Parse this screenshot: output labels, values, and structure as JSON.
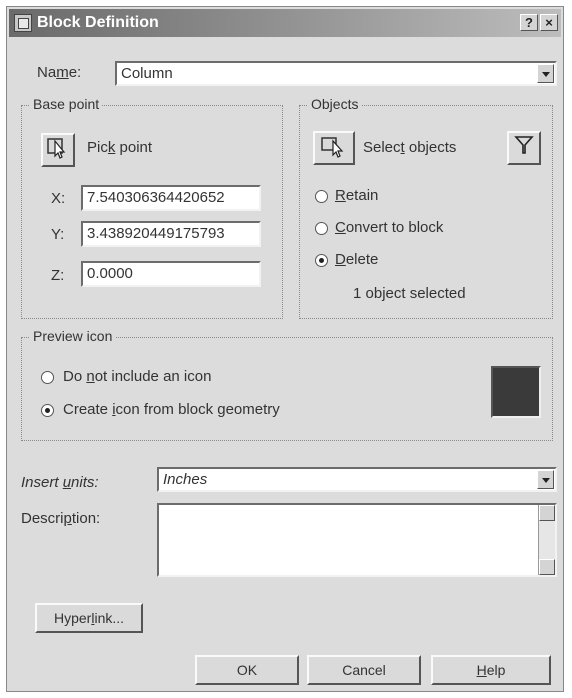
{
  "window": {
    "title": "Block Definition",
    "help_glyph": "?",
    "close_glyph": "×"
  },
  "name": {
    "label_pre": "Na",
    "label_key": "m",
    "label_post": "e:",
    "value": "Column"
  },
  "base_point": {
    "title": "Base point",
    "pick_label_pre": "Pic",
    "pick_label_key": "k",
    "pick_label_post": " point",
    "x_label": "X:",
    "x_value": "7.540306364420652",
    "y_label": "Y:",
    "y_value": "3.438920449175793",
    "z_label": "Z:",
    "z_value": "0.0000",
    "pick_icon": "pick-point-icon"
  },
  "objects": {
    "title": "Objects",
    "select_label_pre": "Selec",
    "select_label_key": "t",
    "select_label_post": " objects",
    "retain": {
      "key": "R",
      "rest": "etain",
      "selected": false
    },
    "convert": {
      "key": "C",
      "rest": "onvert to block",
      "selected": false
    },
    "delete": {
      "key": "D",
      "rest": "elete",
      "selected": true
    },
    "status": "1 object selected",
    "select_icon": "select-objects-icon",
    "filter_icon": "quick-select-filter-icon"
  },
  "preview": {
    "title": "Preview icon",
    "opt1_pre": "Do ",
    "opt1_key": "n",
    "opt1_post": "ot include an icon",
    "opt2_pre": "Create ",
    "opt2_key": "i",
    "opt2_post": "con from block geometry",
    "selected": "create",
    "swatch_color": "#3a3a3a"
  },
  "insert_units": {
    "label_pre": "Insert ",
    "label_key": "u",
    "label_post": "nits:",
    "value": "Inches"
  },
  "description": {
    "label_pre": "Descri",
    "label_key": "p",
    "label_post": "tion:",
    "value": ""
  },
  "buttons": {
    "hyperlink_pre": "Hyper",
    "hyperlink_key": "l",
    "hyperlink_post": "ink...",
    "ok": "OK",
    "cancel": "Cancel",
    "help_key": "H",
    "help_rest": "elp"
  }
}
